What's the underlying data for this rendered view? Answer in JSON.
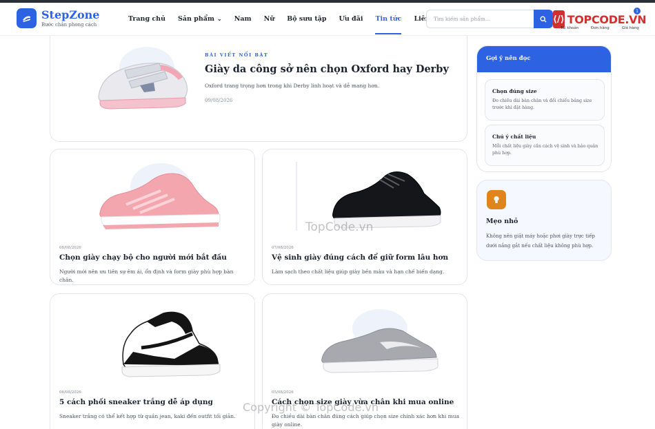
{
  "brand": {
    "name": "StepZone",
    "tagline": "Bước chân phong cách"
  },
  "nav": {
    "items": [
      {
        "label": "Trang chủ"
      },
      {
        "label": "Sản phẩm",
        "has_caret": true
      },
      {
        "label": "Nam"
      },
      {
        "label": "Nữ"
      },
      {
        "label": "Bộ sưu tập"
      },
      {
        "label": "Ưu đãi"
      },
      {
        "label": "Tin tức",
        "active": true
      },
      {
        "label": "Liên hệ"
      }
    ]
  },
  "search": {
    "placeholder": "Tìm kiếm sản phẩm..."
  },
  "account": {
    "login_label": "Tài khoản",
    "orders_label": "Đơn hàng",
    "cart_label": "Giỏ hàng",
    "cart_count": "1"
  },
  "watermark": {
    "logo_text": "TOPCODE.VN",
    "center_text": "TopCode.vn",
    "copyright_text": "Copyright © TopCode.vn"
  },
  "featured": {
    "badge": "BÀI VIẾT NỔI BẬT",
    "title": "Giày da công sở nên chọn Oxford hay Derby",
    "excerpt": "Oxford trang trọng hơn trong khi Derby linh hoạt và dễ mang hơn.",
    "date": "09/08/2026"
  },
  "articles": [
    {
      "date": "08/08/2026",
      "title": "Chọn giày chạy bộ cho người mới bắt đầu",
      "excerpt": "Người mới nên ưu tiên sự êm ái, ổn định và form giày phù hợp bàn chân."
    },
    {
      "date": "07/08/2026",
      "title": "Vệ sinh giày đúng cách để giữ form lâu hơn",
      "excerpt": "Làm sạch theo chất liệu giúp giày bền màu và hạn chế biến dạng."
    },
    {
      "date": "06/08/2026",
      "title": "5 cách phối sneaker trắng dễ áp dụng",
      "excerpt": "Sneaker trắng có thể kết hợp từ quần jean, kaki đến outfit tối giản."
    },
    {
      "date": "05/08/2026",
      "title": "Cách chọn size giày vừa chân khi mua online",
      "excerpt": "Đo chiều dài bàn chân đúng cách giúp chọn size chính xác hơn khi mua giày online."
    }
  ],
  "sidebar": {
    "suggest_title": "Gợi ý nên đọc",
    "tips": [
      {
        "title": "Chọn đúng size",
        "desc": "Đo chiều dài bàn chân và đối chiếu bảng size trước khi đặt hàng."
      },
      {
        "title": "Chú ý chất liệu",
        "desc": "Mỗi chất liệu giày cần cách vệ sinh và bảo quản phù hợp."
      }
    ],
    "note": {
      "icon": "lightbulb-icon",
      "title": "Mẹo nhỏ",
      "text": "Không nên giặt máy hoặc phơi giày trực tiếp dưới nắng gắt nếu chất liệu không phù hợp."
    }
  },
  "colors": {
    "accent": "#2d63e2",
    "bulb": "#e0841c",
    "watermark_red": "#d32f2f"
  }
}
